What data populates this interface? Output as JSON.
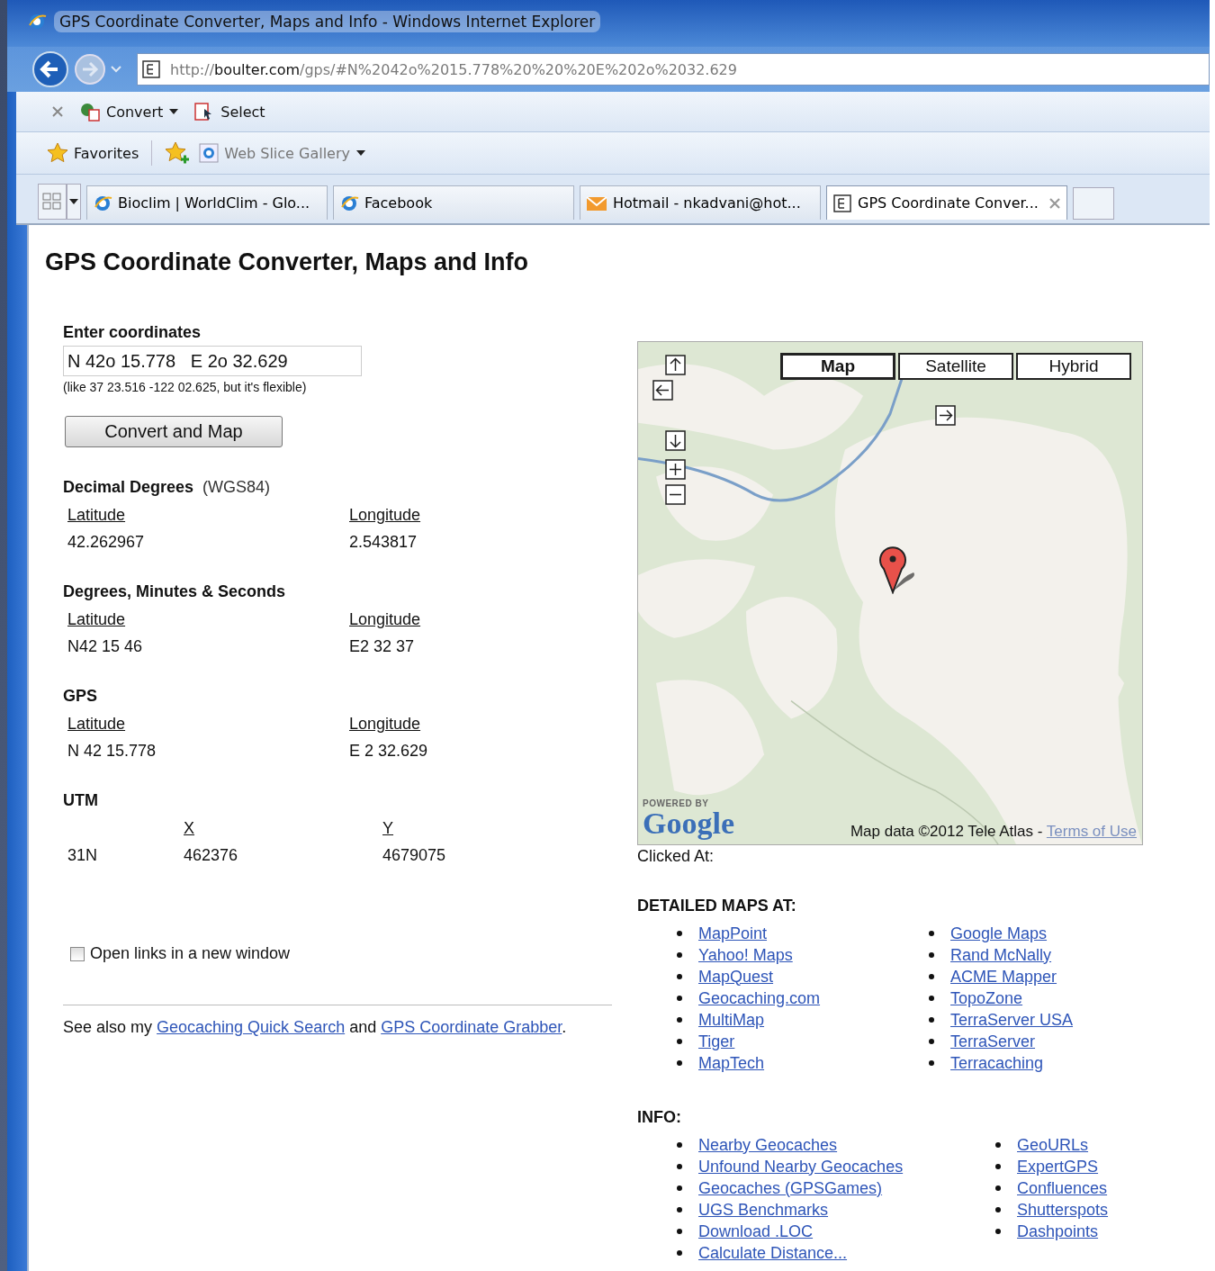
{
  "window": {
    "title": "GPS Coordinate Converter, Maps and Info - Windows Internet Explorer"
  },
  "address_bar": {
    "url": "http://**boulter.com**/gps/#N%2042o%2015.778%20%20%20E%202o%2032.629"
  },
  "command_bar": {
    "items": [
      {
        "label": "Convert",
        "kind": "dropdown"
      },
      {
        "label": "Select",
        "kind": "button"
      }
    ]
  },
  "favorites_bar": {
    "favorites": "Favorites",
    "items": [
      {
        "label": "Web Slice Gallery"
      }
    ]
  },
  "tabs": [
    {
      "label": "Bioclim | WorldClim - Glo...",
      "kind": "ie",
      "selected": false
    },
    {
      "label": "Facebook",
      "kind": "ie",
      "selected": false
    },
    {
      "label": "Hotmail - nkadvani@hot...",
      "kind": "mail",
      "selected": false
    },
    {
      "label": "GPS Coordinate Conver...",
      "kind": "page",
      "selected": true
    }
  ],
  "page": {
    "title": "GPS Coordinate Converter, Maps and Info",
    "form": {
      "label": "Enter coordinates",
      "value": "N 42o 15.778   E 2o 32.629",
      "hint": "(like 37 23.516 -122 02.625, but it's flexible)",
      "button": "Convert and Map"
    },
    "sections": [
      {
        "heading": "Decimal Degrees",
        "note": "(WGS84)",
        "kind": "pair",
        "columns": [
          "Latitude",
          "Longitude"
        ],
        "values": [
          "42.262967",
          "2.543817"
        ]
      },
      {
        "heading": "Degrees, Minutes & Seconds",
        "kind": "pair",
        "columns": [
          "Latitude",
          "Longitude"
        ],
        "values": [
          "N42 15 46",
          "E2 32 37"
        ]
      },
      {
        "heading": "GPS",
        "kind": "pair",
        "columns": [
          "Latitude",
          "Longitude"
        ],
        "values": [
          "N 42 15.778",
          "E 2 32.629"
        ]
      },
      {
        "heading": "UTM",
        "kind": "utm",
        "columns": [
          "X",
          "Y"
        ],
        "values": [
          "31N",
          "462376",
          "4679075"
        ]
      }
    ],
    "new_window": {
      "label": "Open links in a new window",
      "checked": false
    },
    "see_also": {
      "before": "See also my ",
      "link_1": "Geocaching Quick Search",
      "middle": " and ",
      "link_2": "GPS Coordinate Grabber",
      "after": "."
    },
    "map": {
      "types": [
        {
          "label": "Map",
          "selected": true
        },
        {
          "label": "Satellite",
          "selected": false
        },
        {
          "label": "Hybrid",
          "selected": false
        }
      ],
      "logo_caption": "POWERED BY",
      "logo": "Google",
      "attribution": "Map data ©2012 Tele Atlas - ",
      "terms": "Terms of Use"
    },
    "clicked_at": "Clicked At:",
    "detailed_maps": {
      "heading": "DETAILED MAPS AT:",
      "columns": [
        [
          "MapPoint",
          "Yahoo! Maps",
          "MapQuest",
          "Geocaching.com",
          "MultiMap",
          "Tiger",
          "MapTech"
        ],
        [
          "Google Maps",
          "Rand McNally",
          "ACME Mapper",
          "TopoZone",
          "TerraServer USA",
          "TerraServer",
          "Terracaching"
        ]
      ]
    },
    "info": {
      "heading": "INFO:",
      "columns": [
        [
          "Nearby Geocaches",
          "Unfound Nearby Geocaches",
          "Geocaches (GPSGames)",
          "UGS Benchmarks",
          "Download .LOC",
          "Calculate Distance..."
        ],
        [
          "GeoURLs",
          "ExpertGPS",
          "Confluences",
          "Shutterspots",
          "Dashpoints"
        ]
      ]
    }
  }
}
